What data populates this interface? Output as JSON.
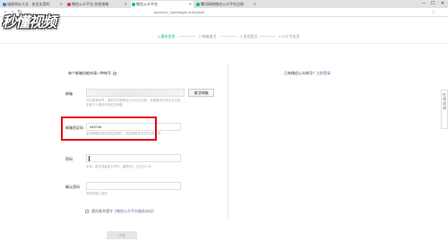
{
  "browser": {
    "tabs": [
      {
        "label": "瑞星网址大全 - 安全实用的",
        "color": "#1e88e5",
        "active": false
      },
      {
        "label": "微信公众平台-扶贫攻略",
        "color": "#e53935",
        "active": false
      },
      {
        "label": "微信公众平台",
        "color": "#07c160",
        "active": true
      },
      {
        "label": "腾讯网络微信公众平台注册",
        "color": "#07c160",
        "active": false
      }
    ],
    "url": "access.ll_mp/Idiwg/s=d.lloadsm",
    "window_controls": [
      "─",
      "☐",
      "✕"
    ]
  },
  "watermark": "秒懂视频",
  "steps": [
    {
      "label": "1 基本信息",
      "active": true
    },
    {
      "label": "2 邮箱激活",
      "active": false
    },
    {
      "label": "3 信息登记",
      "active": false
    },
    {
      "label": "4 公众号信息",
      "active": false
    }
  ],
  "form": {
    "title": "每个邮箱仅能申请一种帐号",
    "email_label": "邮箱",
    "email_value": "",
    "activate_button": "激活邮箱",
    "email_hint": "作为登录帐号，请填写未被微信公众平台注册，未被微信开放平台注册，未被个人微信号绑定的邮箱",
    "code_label": "邮箱验证码",
    "code_value": "040746",
    "code_hint": "激活邮箱后将收到验证邮件，请回填邮件中的6位验证码",
    "password_label": "密码",
    "password_hint": "字母、数字或者英文符号，最短8位，区分大小写",
    "confirm_label": "确认密码",
    "confirm_hint": "请再次输入密码",
    "agree_prefix": "我同意并遵守",
    "agree_link": "《微信公众平台服务协议》",
    "submit": "注册"
  },
  "right_panel": {
    "text": "已有微信公众帐号？",
    "link": "立即登录"
  },
  "side_widget": [
    "在",
    "线",
    "咨",
    "询"
  ]
}
